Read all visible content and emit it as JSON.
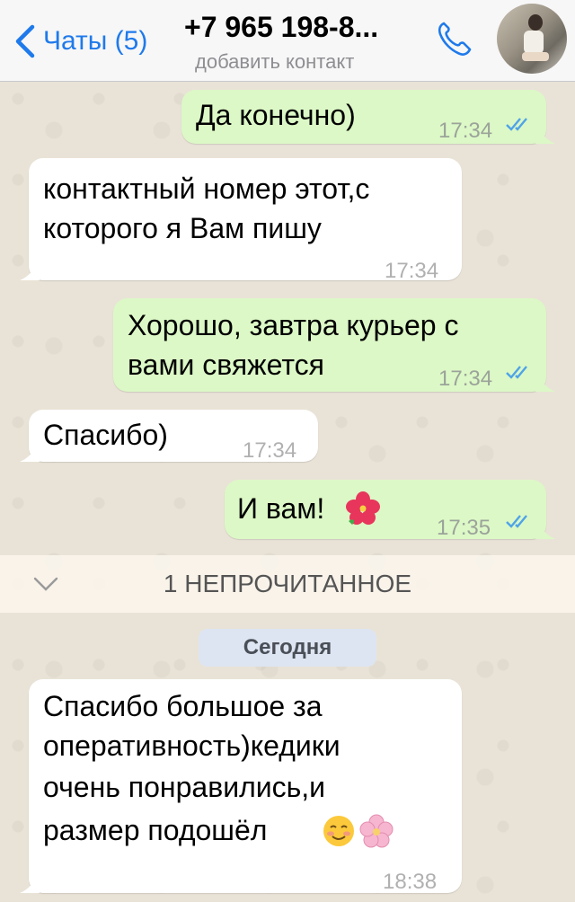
{
  "header": {
    "back_label": "Чаты (5)",
    "title": "+7 965 198-8...",
    "subtitle": "добавить контакт"
  },
  "messages": [
    {
      "direction": "out",
      "text": "Да конечно)",
      "time": "17:34",
      "status": "read"
    },
    {
      "direction": "in",
      "lines": [
        "контактный номер этот,с",
        "которого я Вам пишу"
      ],
      "time": "17:34"
    },
    {
      "direction": "out",
      "lines": [
        "Хорошо, завтра курьер с",
        "вами свяжется"
      ],
      "time": "17:34",
      "status": "read"
    },
    {
      "direction": "in",
      "text": "Спасибо)",
      "time": "17:34"
    },
    {
      "direction": "out",
      "text": "И вам!",
      "emoji": "hibiscus",
      "time": "17:35",
      "status": "read"
    },
    {
      "direction": "in",
      "lines": [
        "Спасибо большое за",
        "оперативность)кедики",
        "очень понравились,и",
        "размер подошёл"
      ],
      "emoji": [
        "smiling-face",
        "cherry-blossom"
      ],
      "time": "18:38"
    }
  ],
  "unread_divider": "1 НЕПРОЧИТАННОЕ",
  "date_separator": "Сегодня",
  "colors": {
    "accent": "#1f7aeb",
    "outgoing_bubble": "#dcf8c6",
    "incoming_bubble": "#ffffff",
    "read_ticks": "#4fa3e8"
  },
  "icons": {
    "back": "chevron-left-icon",
    "call": "phone-icon",
    "read_status": "double-check-icon",
    "divider": "chevron-down-icon"
  }
}
